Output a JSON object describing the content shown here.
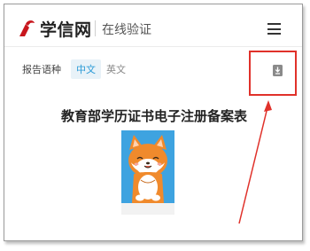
{
  "header": {
    "brand": "学信网",
    "subtitle": "在线验证"
  },
  "language_bar": {
    "label": "报告语种",
    "options": [
      "中文",
      "英文"
    ],
    "selected": "中文"
  },
  "document": {
    "title": "教育部学历证书电子注册备案表"
  },
  "icons": {
    "logo": "xuexin-logo-icon",
    "menu": "hamburger-menu-icon",
    "download": "download-file-icon"
  },
  "colors": {
    "accent": "#2a9ad6",
    "annotation": "#e0312a",
    "photo_bg": "#3ea3e0"
  }
}
